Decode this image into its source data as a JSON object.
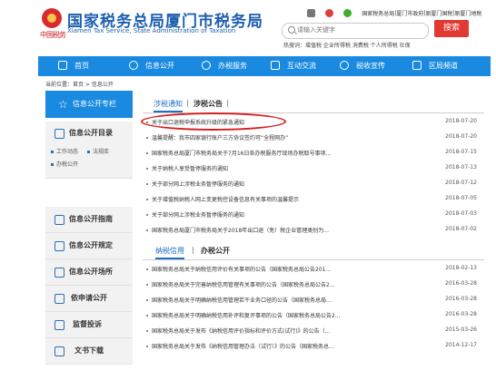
{
  "header": {
    "title": "国家税务总局厦门市税务局",
    "subtitle": "Xiamen Tax Service, State Administration of Taxation",
    "logo_text": "中国税务",
    "top_links": [
      "国家税务总局",
      "厦门市政府",
      "原厦门国税",
      "原厦门地税"
    ],
    "search_placeholder": "请输入关键字",
    "search_button": "搜索",
    "hot_label": "热搜词：",
    "hot_words": "增值税  企业所得税  消费税  个人所得税  社保"
  },
  "nav": [
    {
      "label": "首页",
      "icon": "home-icon"
    },
    {
      "label": "信息公开",
      "icon": "info-icon"
    },
    {
      "label": "办税服务",
      "icon": "service-icon"
    },
    {
      "label": "互动交流",
      "icon": "chat-icon"
    },
    {
      "label": "税收宣传",
      "icon": "speaker-icon"
    },
    {
      "label": "区局频道",
      "icon": "grid-icon"
    }
  ],
  "breadcrumb": "当前位置：首页 > 信息公开",
  "sidebar": {
    "top": "信息公开专栏",
    "catalog_title": "信息公开目录",
    "catalog_items": [
      "工作动态",
      "法规库",
      "办税公开"
    ],
    "sections": [
      "信息公开指南",
      "信息公开规定",
      "信息公开场所",
      "依申请公开",
      "监督投诉",
      "文书下载"
    ]
  },
  "panel1": {
    "tabs": [
      "涉税通知",
      "涉税公告"
    ],
    "items": [
      {
        "title": "关于出口退税申报系统升级的紧急通知",
        "date": "2018-07-20"
      },
      {
        "title": "温馨提醒：我市四家银行账户三方协议签约可“全程网办”",
        "date": "2018-07-20"
      },
      {
        "title": "国家税务总局厦门市税务局关于7月16日各办税服务厅现场办税取号事项...",
        "date": "2018-07-15"
      },
      {
        "title": "关于纳税人享受暂停服务的通知",
        "date": "2018-07-13"
      },
      {
        "title": "关于部分网上涉税业务暂停服务的通知",
        "date": "2018-07-12"
      },
      {
        "title": "关于增值税纳税人网上变更税控设备信息有关事项的温馨提示",
        "date": "2018-07-05"
      },
      {
        "title": "关于部分网上涉税业务暂停服务的通知",
        "date": "2018-07-03"
      },
      {
        "title": "国家税务总局厦门市税务局关于2018年出口退（免）税企业管理类别为...",
        "date": "2018-07-02"
      }
    ]
  },
  "panel2": {
    "tabs": [
      "纳税信用",
      "办税公开"
    ],
    "items": [
      {
        "title": "国家税务总局关于纳税信用评价有关事项的公告（国家税务总局公告201...",
        "date": "2018-02-13"
      },
      {
        "title": "国家税务总局关于完善纳税信用管理有关事项的公告（国家税务总局公告2...",
        "date": "2016-03-28"
      },
      {
        "title": "国家税务总局关于明确纳税信用管理若干业务口径的公告（国家税务总局...",
        "date": "2016-03-28"
      },
      {
        "title": "国家税务总局关于明确纳税信用补评和复评事项的公告（国家税务总局公告2...",
        "date": "2016-03-28"
      },
      {
        "title": "国家税务总局关于发布《纳税信用评价指标和评价方式(试行)》的公告（...",
        "date": "2015-03-26"
      },
      {
        "title": "国家税务总局关于发布《纳税信用管理办法（试行）》的公告（国家税务总...",
        "date": "2014-12-17"
      }
    ]
  },
  "colors": {
    "brand_blue": "#1a8ae0",
    "title_blue": "#1d5fb1",
    "search_red": "#e03a32",
    "annotation_red": "#d81e1e"
  }
}
